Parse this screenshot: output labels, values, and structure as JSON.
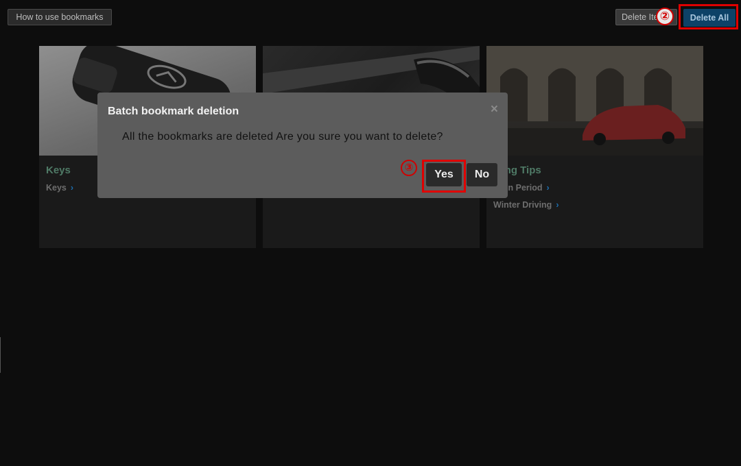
{
  "toolbar": {
    "how_to_label": "How to use bookmarks",
    "delete_items_label": "Delete Items",
    "delete_all_label": "Delete All"
  },
  "annotations": {
    "marker_delete_all": "②",
    "marker_yes": "③",
    "highlight_color": "#e00000"
  },
  "cards": [
    {
      "title": "Keys",
      "image": "mazda-smart-key-photo",
      "links": [
        "Keys"
      ]
    },
    {
      "title": "",
      "image": "car-interior-door-handle-photo",
      "links": []
    },
    {
      "title": "Driving Tips",
      "title_visible": "iving Tips",
      "image": "red-mazda6-city-street-photo",
      "links": [
        "Break-In Period",
        "Winter Driving"
      ],
      "links_visible": [
        "ak-In Period",
        "Winter Driving"
      ]
    }
  ],
  "dialog": {
    "title": "Batch bookmark deletion",
    "close_glyph": "×",
    "message": "All the bookmarks are deleted Are you sure you want to delete?",
    "yes_label": "Yes",
    "no_label": "No"
  },
  "colors": {
    "background": "#0d0d0d",
    "dialog_bg": "#5c5c5c",
    "delete_all_bg": "#0d4267",
    "link_chevron": "#1c6fb0",
    "card_title": "#4f7a66"
  }
}
